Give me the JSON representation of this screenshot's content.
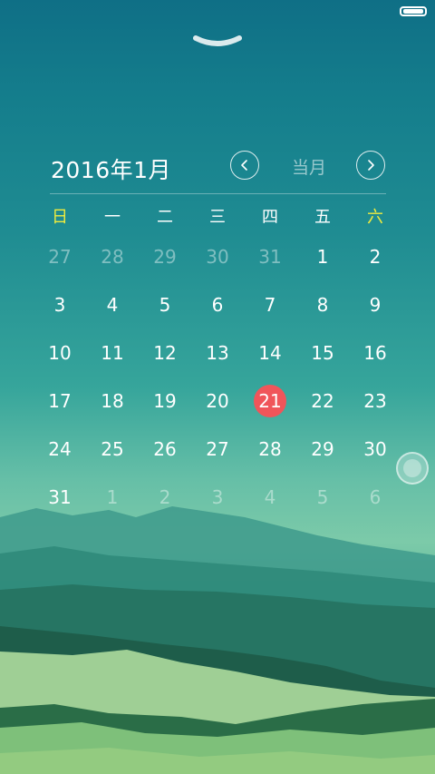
{
  "calendar": {
    "title": "2016年1月",
    "today_label": "当月",
    "weekdays": [
      {
        "label": "日",
        "weekend": true
      },
      {
        "label": "一",
        "weekend": false
      },
      {
        "label": "二",
        "weekend": false
      },
      {
        "label": "三",
        "weekend": false
      },
      {
        "label": "四",
        "weekend": false
      },
      {
        "label": "五",
        "weekend": false
      },
      {
        "label": "六",
        "weekend": true
      }
    ],
    "weeks": [
      [
        {
          "d": "27",
          "m": "prev"
        },
        {
          "d": "28",
          "m": "prev"
        },
        {
          "d": "29",
          "m": "prev"
        },
        {
          "d": "30",
          "m": "prev"
        },
        {
          "d": "31",
          "m": "prev"
        },
        {
          "d": "1",
          "m": "cur"
        },
        {
          "d": "2",
          "m": "cur"
        }
      ],
      [
        {
          "d": "3",
          "m": "cur"
        },
        {
          "d": "4",
          "m": "cur"
        },
        {
          "d": "5",
          "m": "cur"
        },
        {
          "d": "6",
          "m": "cur"
        },
        {
          "d": "7",
          "m": "cur"
        },
        {
          "d": "8",
          "m": "cur"
        },
        {
          "d": "9",
          "m": "cur"
        }
      ],
      [
        {
          "d": "10",
          "m": "cur"
        },
        {
          "d": "11",
          "m": "cur"
        },
        {
          "d": "12",
          "m": "cur"
        },
        {
          "d": "13",
          "m": "cur"
        },
        {
          "d": "14",
          "m": "cur"
        },
        {
          "d": "15",
          "m": "cur"
        },
        {
          "d": "16",
          "m": "cur"
        }
      ],
      [
        {
          "d": "17",
          "m": "cur"
        },
        {
          "d": "18",
          "m": "cur"
        },
        {
          "d": "19",
          "m": "cur"
        },
        {
          "d": "20",
          "m": "cur"
        },
        {
          "d": "21",
          "m": "cur",
          "today": true
        },
        {
          "d": "22",
          "m": "cur"
        },
        {
          "d": "23",
          "m": "cur"
        }
      ],
      [
        {
          "d": "24",
          "m": "cur"
        },
        {
          "d": "25",
          "m": "cur"
        },
        {
          "d": "26",
          "m": "cur"
        },
        {
          "d": "27",
          "m": "cur"
        },
        {
          "d": "28",
          "m": "cur"
        },
        {
          "d": "29",
          "m": "cur"
        },
        {
          "d": "30",
          "m": "cur"
        }
      ],
      [
        {
          "d": "31",
          "m": "cur"
        },
        {
          "d": "1",
          "m": "next"
        },
        {
          "d": "2",
          "m": "next"
        },
        {
          "d": "3",
          "m": "next"
        },
        {
          "d": "4",
          "m": "next"
        },
        {
          "d": "5",
          "m": "next"
        },
        {
          "d": "6",
          "m": "next"
        }
      ]
    ]
  },
  "icons": {
    "prev": "chevron-left-icon",
    "next": "chevron-right-icon",
    "handle": "pull-down-handle-icon",
    "battery": "battery-icon"
  },
  "colors": {
    "today_highlight": "#f0555a",
    "weekend_header": "#f1ec3d"
  }
}
